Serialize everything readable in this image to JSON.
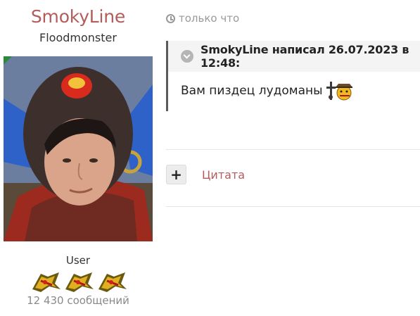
{
  "author": {
    "name": "SmokyLine",
    "title": "Floodmonster",
    "role": "User",
    "post_count": "12 430 сообщений",
    "online": true,
    "rank_icons": [
      "rank-icon",
      "rank-icon",
      "rank-icon"
    ],
    "name_color": "#b35c5c"
  },
  "post": {
    "time": "только что",
    "time_icon": "clock-icon",
    "quote": {
      "header": "SmokyLine написал 26.07.2023 в 12:48:",
      "collapse_icon": "chevron-down-icon",
      "body": "Вам пиздец лудоманы",
      "smiley": "smiley-with-gun-icon"
    },
    "actions": {
      "plus_label": "+",
      "quote_label": "Цитата"
    }
  },
  "colors": {
    "accent": "#b35c5c",
    "quote_border": "#5a5a5a",
    "quote_header_bg": "#f4f4f4",
    "online": "#2a8a3a"
  }
}
